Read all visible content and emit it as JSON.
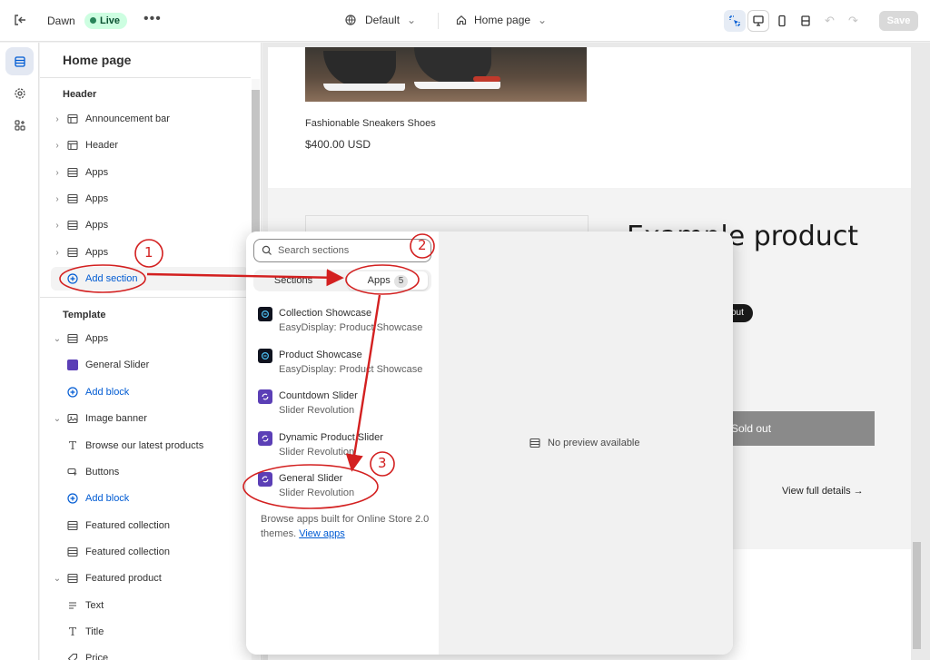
{
  "topbar": {
    "theme_name": "Dawn",
    "live_badge": "Live",
    "more": "•••",
    "preset": "Default",
    "page_selector": "Home page",
    "undo": "↶",
    "redo": "↷",
    "save_label": "Save",
    "device_icons": [
      "inspector-icon",
      "desktop-icon",
      "mobile-icon",
      "fullwidth-icon"
    ]
  },
  "rail": {
    "items": [
      "sections-icon",
      "settings-icon",
      "apps-icon"
    ]
  },
  "sidebar": {
    "title": "Home page",
    "header_group": "Header",
    "header_items": [
      {
        "label": "Announcement bar"
      },
      {
        "label": "Header"
      },
      {
        "label": "Apps"
      },
      {
        "label": "Apps"
      },
      {
        "label": "Apps"
      },
      {
        "label": "Apps"
      }
    ],
    "add_section": "Add section",
    "template_group": "Template",
    "template_items": [
      {
        "label": "Apps"
      },
      {
        "label": "General Slider"
      },
      {
        "label": "Add block"
      },
      {
        "label": "Image banner"
      },
      {
        "label": "Browse our latest products"
      },
      {
        "label": "Buttons"
      },
      {
        "label": "Add block"
      },
      {
        "label": "Featured collection"
      },
      {
        "label": "Featured collection"
      },
      {
        "label": "Featured product"
      },
      {
        "label": "Text"
      },
      {
        "label": "Title"
      },
      {
        "label": "Price"
      }
    ]
  },
  "preview": {
    "product_name": "Fashionable Sneakers Shoes",
    "product_price": "$400.00 USD",
    "example_product": "Example product",
    "sold_out_badge": "out",
    "sold_out_button": "Sold out",
    "view_details": "View full details  →"
  },
  "popover": {
    "search_placeholder": "Search sections",
    "tab_sections": "Sections",
    "tab_apps": "Apps",
    "apps_count": "5",
    "apps": [
      {
        "name": "Collection Showcase",
        "provider": "EasyDisplay: Product Showcase",
        "color": "#10131f"
      },
      {
        "name": "Product Showcase",
        "provider": "EasyDisplay: Product Showcase",
        "color": "#10131f"
      },
      {
        "name": "Countdown Slider",
        "provider": "Slider Revolution",
        "color": "#5b3fb6"
      },
      {
        "name": "Dynamic Product Slider",
        "provider": "Slider Revolution",
        "color": "#5b3fb6"
      },
      {
        "name": "General Slider",
        "provider": "Slider Revolution",
        "color": "#5b3fb6"
      }
    ],
    "browse_text": "Browse apps built for Online Store 2.0 themes.",
    "browse_link": "View apps",
    "no_preview": "No preview available"
  },
  "annotations": {
    "step1": "1",
    "step2": "2",
    "step3": "3",
    "color": "#d32020"
  }
}
